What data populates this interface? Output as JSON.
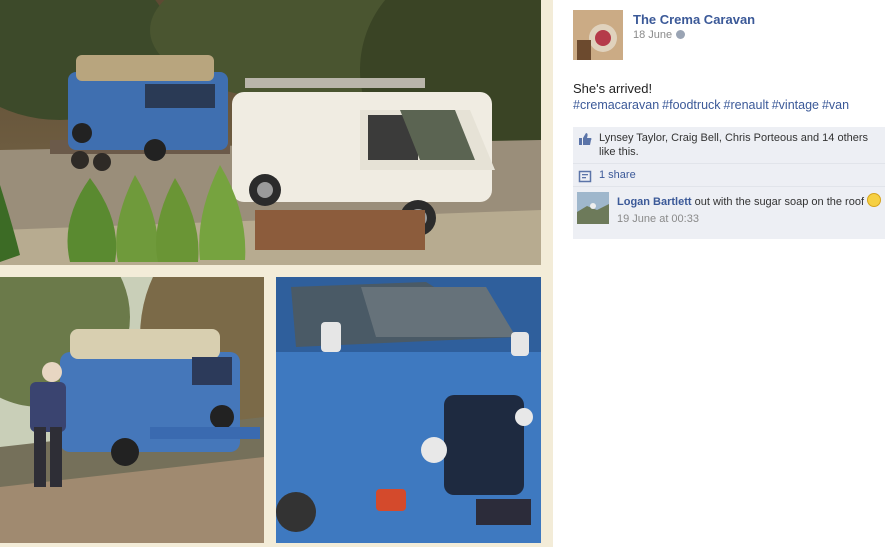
{
  "post": {
    "page_name": "The Crema Caravan",
    "date": "18 June",
    "message": "She's arrived!",
    "hashtags": [
      "#cremacaravan",
      "#foodtruck",
      "#renault",
      "#vintage",
      "#van"
    ]
  },
  "feedback": {
    "likes_text": "Lynsey Taylor, Craig Bell, Chris Porteous and 14 others like this.",
    "shares_text": "1 share"
  },
  "comment": {
    "author": "Logan Bartlett",
    "text": "out with the sugar soap on the roof",
    "time": "19 June at 00:33"
  },
  "icons": {
    "globe": "globe-icon",
    "like": "thumbs-up-icon",
    "share": "share-icon",
    "smiley": "smiley-emoticon"
  },
  "colors": {
    "link": "#3b5998",
    "feedback_bg": "#edeff4",
    "meta_text": "#8a8a8a"
  }
}
